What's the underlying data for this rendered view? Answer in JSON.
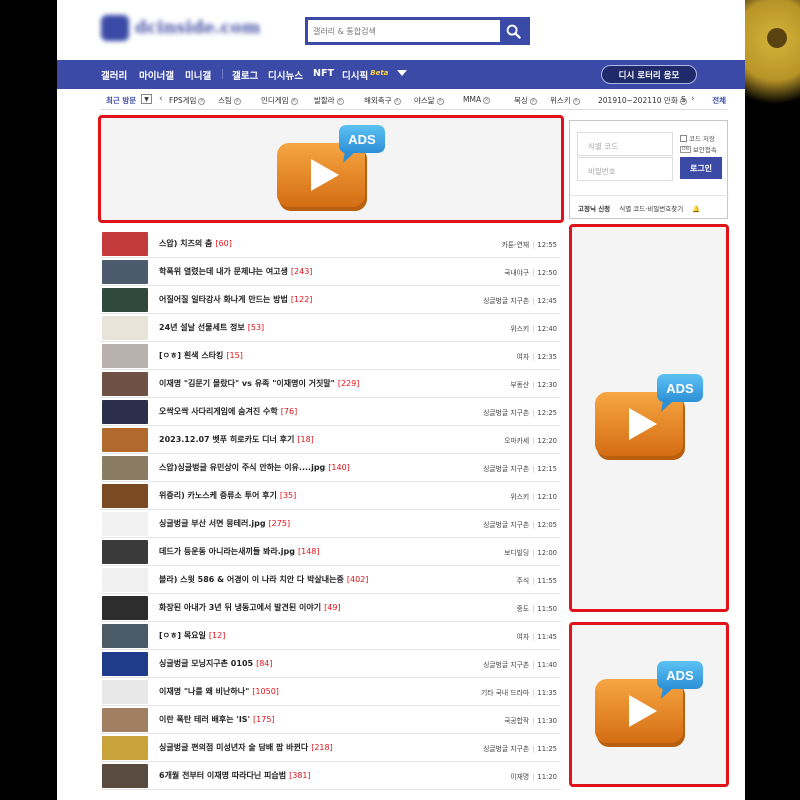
{
  "search": {
    "placeholder": "갤러리 & 통합검색"
  },
  "nav": {
    "items": [
      "갤러리",
      "마이너갤",
      "미니갤",
      "갤로그",
      "디시뉴스",
      "NFT",
      "디시픽"
    ],
    "beta": "Beta",
    "lottery": "디시 로터리 응모"
  },
  "recent": {
    "label": "최근 방문",
    "chips": [
      "FPS게임",
      "스팀",
      "인디게임",
      "발할라",
      "해외축구",
      "야스닮",
      "MMA",
      "복싱",
      "위스키",
      "201910~202110 만화",
      "S"
    ],
    "all": "전체"
  },
  "login": {
    "id_placeholder": "식별 코드",
    "pw_placeholder": "비밀번호",
    "save_code": "코드 저장",
    "secure_tag": "ON",
    "secure": "보안접속",
    "button": "로그인",
    "signup": "고정닉 신청",
    "find": "식별 코드·비밀번호찾기"
  },
  "colors": {
    "brand": "#3b4aa6",
    "ad_border": "#e0131b",
    "count": "#e0131b"
  },
  "posts": [
    {
      "title": "스압) 치즈의 춤",
      "count": "[60]",
      "gallery": "카툰-연재",
      "time": "12:55",
      "thumb": "#c43a3a"
    },
    {
      "title": "학폭위 열렸는데 내가 문제냐는 여고생",
      "count": "[243]",
      "gallery": "국내야구",
      "time": "12:50",
      "thumb": "#4c5a6e"
    },
    {
      "title": "어질어질 일타강사 화나게 만드는 방법",
      "count": "[122]",
      "gallery": "싱글벙글 지구촌",
      "time": "12:45",
      "thumb": "#2f4a3c"
    },
    {
      "title": "24년 설날 선물세트 정보",
      "count": "[53]",
      "gallery": "위스키",
      "time": "12:40",
      "thumb": "#e9e4d8"
    },
    {
      "title": "[ㅇㅎ] 흰색 스타킹",
      "count": "[15]",
      "gallery": "여자",
      "time": "12:35",
      "thumb": "#b9b1ad"
    },
    {
      "title": "이재명 \"김문기 몰랐다\" vs 유족 \"이재명이 거짓말\"",
      "count": "[229]",
      "gallery": "부동산",
      "time": "12:30",
      "thumb": "#6e5144"
    },
    {
      "title": "오싹오싹 사다리게임에 숨겨진 수학",
      "count": "[76]",
      "gallery": "싱글벙글 지구촌",
      "time": "12:25",
      "thumb": "#2b2f4a"
    },
    {
      "title": "2023.12.07 벳푸 히로카도 디너 후기",
      "count": "[18]",
      "gallery": "오마카세",
      "time": "12:20",
      "thumb": "#b06a2e"
    },
    {
      "title": "스압)싱글벙글 유민상이 주식 안하는 이유....jpg",
      "count": "[140]",
      "gallery": "싱글벙글 지구촌",
      "time": "12:15",
      "thumb": "#8a7b63"
    },
    {
      "title": "위증리) 카노스케 증류소 투어 후기",
      "count": "[35]",
      "gallery": "위스키",
      "time": "12:10",
      "thumb": "#7a4a22"
    },
    {
      "title": "싱글벙글 부산 서면 뭉테러.jpg",
      "count": "[275]",
      "gallery": "싱글벙글 지구촌",
      "time": "12:05",
      "thumb": "#f2f2f2"
    },
    {
      "title": "데드가 등운동 아니라는새끼들 봐라.jpg",
      "count": "[148]",
      "gallery": "보디빌딩",
      "time": "12:00",
      "thumb": "#3a3a3a"
    },
    {
      "title": "블라) 스윗 586 & 어경이 이 나라 치안 다 박살내는중",
      "count": "[402]",
      "gallery": "주식",
      "time": "11:55",
      "thumb": "#f0f0f0"
    },
    {
      "title": "화장된 아내가 3년 뒤 냉동고에서 발견된 이야기",
      "count": "[49]",
      "gallery": "중도",
      "time": "11:50",
      "thumb": "#2d2d2d"
    },
    {
      "title": "[ㅇㅎ] 목요일",
      "count": "[12]",
      "gallery": "여자",
      "time": "11:45",
      "thumb": "#4a5a66"
    },
    {
      "title": "싱글벙글 모닝지구촌 0105",
      "count": "[84]",
      "gallery": "싱글벙글 지구촌",
      "time": "11:40",
      "thumb": "#1f3c8a"
    },
    {
      "title": "이재명 \"나를 왜 비난하나\"",
      "count": "[1050]",
      "gallery": "기타 국내 드라마",
      "time": "11:35",
      "thumb": "#e8e8e8"
    },
    {
      "title": "이란 폭탄 테러 배후는 'IS'",
      "count": "[175]",
      "gallery": "국공합작",
      "time": "11:30",
      "thumb": "#a08060"
    },
    {
      "title": "싱글벙글 편의점 미성년자 술 담배 팝 바뀐다",
      "count": "[218]",
      "gallery": "싱글벙글 지구촌",
      "time": "11:25",
      "thumb": "#c9a23a"
    },
    {
      "title": "6개월 전부터 이재명 따라다닌 피습범",
      "count": "[381]",
      "gallery": "이재명",
      "time": "11:20",
      "thumb": "#5a4b40"
    }
  ]
}
